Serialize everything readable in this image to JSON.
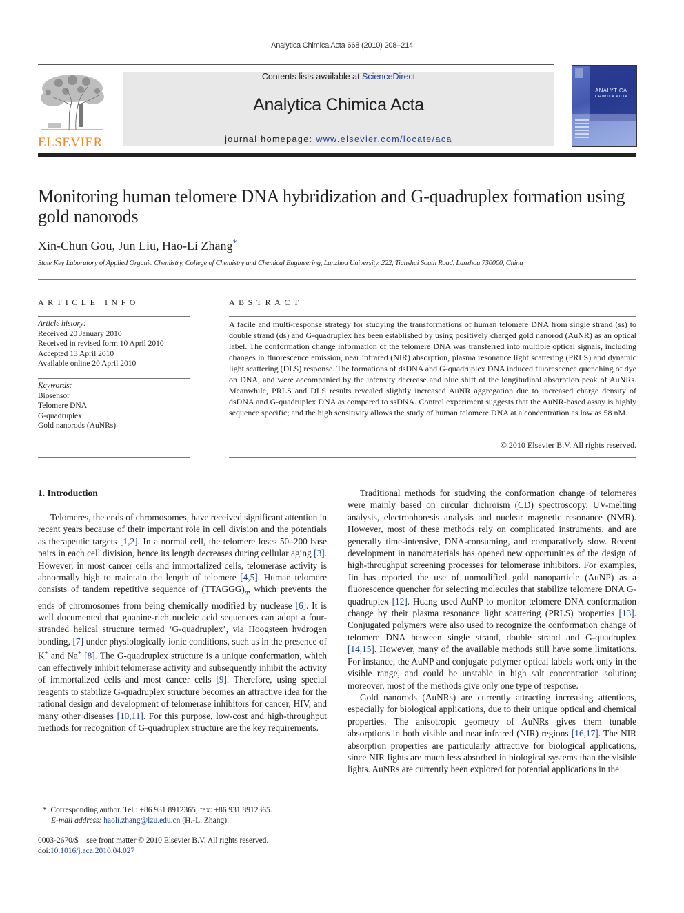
{
  "running_head": "Analytica Chimica Acta 668 (2010) 208–214",
  "banner": {
    "contents_prefix": "Contents lists available at ",
    "contents_link": "ScienceDirect",
    "journal_title": "Analytica Chimica Acta",
    "homepage_prefix": "journal homepage: ",
    "homepage_link": "www.elsevier.com/locate/aca"
  },
  "publisher": {
    "name": "ELSEVIER",
    "brand_color": "#f08a24"
  },
  "cover": {
    "title_line1": "ANALYTICA",
    "title_line2": "CHIMICA ACTA"
  },
  "article": {
    "title": "Monitoring human telomere DNA hybridization and G-quadruplex formation using gold nanorods",
    "authors": "Xin-Chun Gou, Jun Liu, Hao-Li Zhang",
    "corresponding_mark": "*",
    "affiliation": "State Key Laboratory of Applied Organic Chemistry, College of Chemistry and Chemical Engineering, Lanzhou University, 222, Tianshui South Road, Lanzhou 730000, China"
  },
  "article_info": {
    "heading": "ARTICLE INFO",
    "history_label": "Article history:",
    "history": [
      "Received 20 January 2010",
      "Received in revised form 10 April 2010",
      "Accepted 13 April 2010",
      "Available online 20 April 2010"
    ],
    "keywords_label": "Keywords:",
    "keywords": [
      "Biosensor",
      "Telomere DNA",
      "G-quadruplex",
      "Gold nanorods (AuNRs)"
    ]
  },
  "abstract": {
    "heading": "ABSTRACT",
    "text": "A facile and multi-response strategy for studying the transformations of human telomere DNA from single strand (ss) to double strand (ds) and G-quadruplex has been established by using positively charged gold nanorod (AuNR) as an optical label. The conformation change information of the telomere DNA was transferred into multiple optical signals, including changes in fluorescence emission, near infrared (NIR) absorption, plasma resonance light scattering (PRLS) and dynamic light scattering (DLS) response. The formations of dsDNA and G-quadruplex DNA induced fluorescence quenching of dye on DNA, and were accompanied by the intensity decrease and blue shift of the longitudinal absorption peak of AuNRs. Meanwhile, PRLS and DLS results revealed slightly increased AuNR aggregation due to increased charge density of dsDNA and G-quadruplex DNA as compared to ssDNA. Control experiment suggests that the AuNR-based assay is highly sequence specific; and the high sensitivity allows the study of human telomere DNA at a concentration as low as 58 nM.",
    "copyright": "© 2010 Elsevier B.V. All rights reserved."
  },
  "introduction": {
    "heading": "1.  Introduction",
    "left_p1": [
      {
        "t": "Telomeres, the ends of chromosomes, have received significant attention in recent years because of their important role in cell division and the potentials as therapeutic targets "
      },
      {
        "r": "[1,2]"
      },
      {
        "t": ". In a normal cell, the telomere loses 50–200 base pairs in each cell division, hence its length decreases during cellular aging "
      },
      {
        "r": "[3]"
      },
      {
        "t": ". However, in most cancer cells and immortalized cells, telomerase activity is abnormally high to maintain the length of telomere "
      },
      {
        "r": "[4,5]"
      },
      {
        "t": ". Human telomere consists of tandem repetitive sequence of (TTAGGG)"
      },
      {
        "sub": "n"
      },
      {
        "t": ", which prevents the ends of chromosomes from being chemically modified by nuclease "
      },
      {
        "r": "[6]"
      },
      {
        "t": ". It is well documented that guanine-rich nucleic acid sequences can adopt a four-stranded helical structure termed ‘G-quadruplex’, via Hoogsteen hydrogen bonding, "
      },
      {
        "r": "[7]"
      },
      {
        "t": " under physiologically ionic conditions, such as in the presence of K"
      },
      {
        "sup": "+"
      },
      {
        "t": " and Na"
      },
      {
        "sup": "+"
      },
      {
        "t": " "
      },
      {
        "r": "[8]"
      },
      {
        "t": ". The G-quadruplex structure is a unique conformation, which can effectively inhibit telomerase activity and subsequently inhibit the activity of immortalized cells and most cancer cells "
      },
      {
        "r": "[9]"
      },
      {
        "t": ". Therefore, using special reagents to stabilize G-quadruplex structure becomes an attractive idea for the rational design and development of telomerase inhibitors for cancer, HIV, and many other diseases "
      },
      {
        "r": "[10,11]"
      },
      {
        "t": ". For this purpose, low-cost and high-throughput methods for recognition of G-quadruplex structure are the key requirements."
      }
    ],
    "right_p1": [
      {
        "t": "Traditional methods for studying the conformation change of telomeres were mainly based on circular dichroism (CD) spectroscopy, UV-melting analysis, electrophoresis analysis and nuclear magnetic resonance (NMR). However, most of these methods rely on complicated instruments, and are generally time-intensive, DNA-consuming, and comparatively slow. Recent development in nanomaterials has opened new opportunities of the design of high-throughput screening processes for telomerase inhibitors. For examples, Jin has reported the use of unmodified gold nanoparticle (AuNP) as a fluorescence quencher for selecting molecules that stabilize telomere DNA G-quadruplex "
      },
      {
        "r": "[12]"
      },
      {
        "t": ". Huang used AuNP to monitor telomere DNA conformation change by their plasma resonance light scattering (PRLS) properties "
      },
      {
        "r": "[13]"
      },
      {
        "t": ". Conjugated polymers were also used to recognize the conformation change of telomere DNA between single strand, double strand and G-quadruplex "
      },
      {
        "r": "[14,15]"
      },
      {
        "t": ". However, many of the available methods still have some limitations. For instance, the AuNP and conjugate polymer optical labels work only in the visible range, and could be unstable in high salt concentration solution; moreover, most of the methods give only one type of response."
      }
    ],
    "right_p2": [
      {
        "t": "Gold nanorods (AuNRs) are currently attracting increasing attentions, especially for biological applications, due to their unique optical and chemical properties. The anisotropic geometry of AuNRs gives them tunable absorptions in both visible and near infrared (NIR) regions "
      },
      {
        "r": "[16,17]"
      },
      {
        "t": ". The NIR absorption properties are particularly attractive for biological applications, since NIR lights are much less absorbed in biological systems than the visible lights. AuNRs are currently been explored for potential applications in the"
      }
    ]
  },
  "footnote": {
    "mark": "*",
    "corresponding": "Corresponding author. Tel.: +86 931 8912365; fax: +86 931 8912365.",
    "email_label": "E-mail address:",
    "email": "haoli.zhang@lzu.edu.cn",
    "email_suffix": " (H.-L. Zhang).",
    "front_matter": "0003-2670/$ – see front matter © 2010 Elsevier B.V. All rights reserved.",
    "doi_prefix": "doi:",
    "doi": "10.1016/j.aca.2010.04.027"
  },
  "colors": {
    "link": "#1f3f95",
    "banner_bg": "#e8e8e8"
  }
}
